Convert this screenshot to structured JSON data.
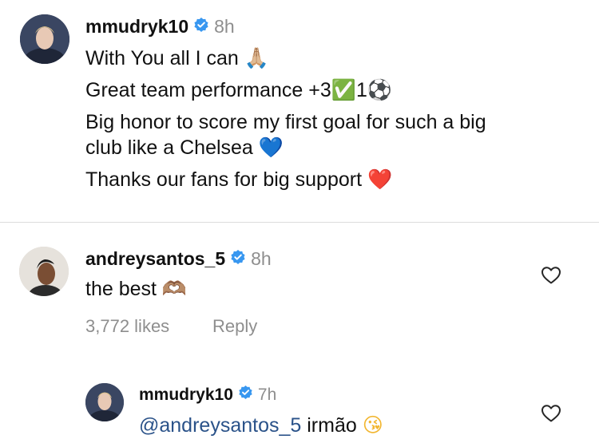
{
  "post": {
    "username": "mmudryk10",
    "time": "8h",
    "line1": "With You all I can",
    "line1_emoji": "🙏🏼",
    "line2_text": "Great team performance +3",
    "line2_check": "✅",
    "line2_after": "1",
    "line2_ball": "⚽",
    "line3": "Big honor to score my first goal for such a big",
    "line4": "club like a Chelsea",
    "line4_emoji": "💙",
    "line5": "Thanks our fans for big support",
    "line5_emoji": "❤️"
  },
  "comment": {
    "username": "andreysantos_5",
    "time": "8h",
    "text": "the best",
    "emoji": "🫶🏽",
    "likes": "3,772 likes",
    "reply_label": "Reply"
  },
  "reply": {
    "username": "mmudryk10",
    "time": "7h",
    "mention": "@andreysantos_5",
    "text": "irmão",
    "emoji": "😘"
  },
  "colors": {
    "verified": "#3897f0",
    "mention": "#2a5289",
    "muted": "#8e8e8e"
  },
  "icons": [
    "verified-badge-icon",
    "heart-outline-icon"
  ]
}
